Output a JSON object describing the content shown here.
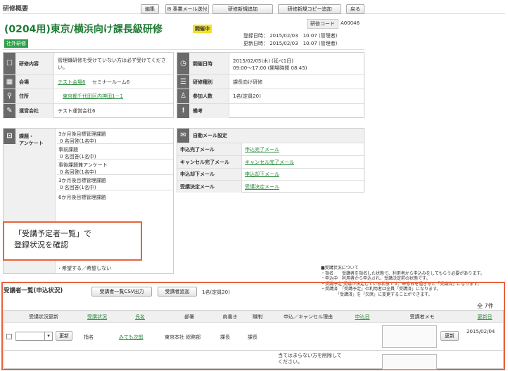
{
  "page": {
    "heading": "研修概要"
  },
  "toolbar": {
    "edit": "編集",
    "send_mail": "✉ 事業メール送付",
    "new_training": "研修新規追加",
    "copy_training": "研修新規コピー追加",
    "back": "戻る"
  },
  "training": {
    "code_label": "研修コード",
    "code": "A00046",
    "title": "(0204用)東京/横浜向け課長級研修",
    "status": "開催中",
    "tag": "社外研修",
    "registered": "登録日時： 2015/02/03　10:07 (管理者)",
    "updated": "更新日時： 2015/02/03　10:07 (管理者)"
  },
  "details": {
    "content_label": "研修内容",
    "content": "管理職研修を受けていない方は必ず受けてください。",
    "venue_label": "会場",
    "venue_link": "テスト会場6",
    "venue_room": "セミナールーム6",
    "address_label": "住所",
    "address": "東京都千代田区内神田1－1",
    "company_label": "運営会社",
    "company": "テスト運営会社6",
    "date_label": "開催日時",
    "date1": "2015/02/05(木) (延べ1日)",
    "date2": "09:00～17:00 (開場時間 08:45)",
    "type_label": "研修種別",
    "type": "課長向け研修",
    "count_label": "参加人数",
    "count": "1名(定員20)",
    "note_label": "備考"
  },
  "survey": {
    "label_line1": "課題・",
    "label_line2": "アンケート",
    "items": [
      {
        "name": "3か月後目標管理課題",
        "ans": "0 名回答(1名中)"
      },
      {
        "name": "事前課題",
        "ans": "0 名回答(1名中)"
      },
      {
        "name": "事後課題兼アンケート",
        "ans": "0 名回答(1名中)"
      },
      {
        "name": "3か月後目標管理課題",
        "ans": "0 名回答(1名中)"
      },
      {
        "name": "6か月後目標管理課題",
        "ans": ""
      }
    ],
    "footer": "・希望する／希望しない"
  },
  "automail": {
    "title": "自動メール設定",
    "rows": [
      {
        "label": "申込完了メール",
        "link": "申込完了メール"
      },
      {
        "label": "キャンセル完了メール",
        "link": "キャンセル完了メール"
      },
      {
        "label": "申込却下メール",
        "link": "申込却下メール"
      },
      {
        "label": "受講決定メール",
        "link": "受講決定メール"
      }
    ]
  },
  "callout": {
    "line1": "「受講予定者一覧」で",
    "line2": "登録状況を確認"
  },
  "legend": [
    "■受講状況について",
    "・指名　　受講者を指名した状態で、利用者から申込みをしてもらう必要があります。",
    "・申込中　利用者から申込され、受講決定前の状態です。",
    "・受講予定 受講が決定している状態です。研修日を過ぎると「受講済」になります。",
    "・受講済　「受講予定」の利用者は全員「受講済」になります。",
    "　　　　「受講済」を「欠席」に変更することができます。"
  ],
  "attendees": {
    "title": "受講者一覧(申込状況)",
    "csv": "受講者一覧CSV出力",
    "add": "受講者追加",
    "count_text": "1名(定員20)",
    "total": "全 7件",
    "headers": [
      "受講状況更新",
      "受講状況",
      "氏名",
      "部署",
      "肩書き",
      "職制",
      "申込／キャンセル理由",
      "申込日",
      "受講者メモ",
      "更新日"
    ],
    "update_btn": "更新",
    "row": {
      "status": "指名",
      "name": "みても次郎",
      "dept": "東京本社 総務部",
      "title": "課長",
      "post": "課長",
      "updated": "2015/02/04"
    },
    "memo_placeholder": "当てはまらない方を削除してください。"
  }
}
